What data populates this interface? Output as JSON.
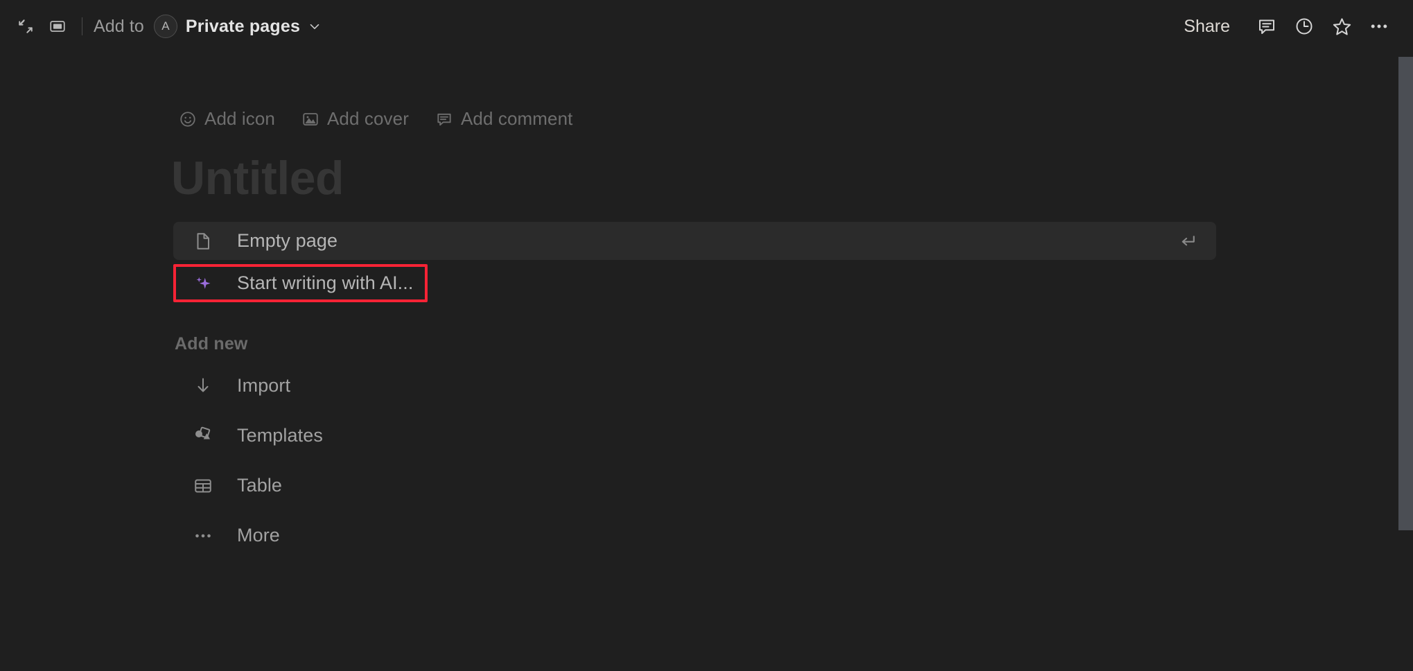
{
  "window": {
    "background": "#1f1f1f"
  },
  "topbar": {
    "expand_icon": "expand-diagonal-icon",
    "sidepeek_icon": "side-peek-icon",
    "add_to_label": "Add to",
    "workspace_avatar_letter": "A",
    "breadcrumb_title": "Private pages",
    "breadcrumb_chevron": "chevron-down-icon",
    "share_label": "Share",
    "comment_icon": "comment-icon",
    "history_icon": "clock-history-icon",
    "favorite_icon": "star-icon",
    "more_icon": "more-horizontal-icon"
  },
  "page": {
    "meta_actions": [
      {
        "icon": "smiley-face-icon",
        "label": "Add icon"
      },
      {
        "icon": "image-icon",
        "label": "Add cover"
      },
      {
        "icon": "comment-icon",
        "label": "Add comment"
      }
    ],
    "title_placeholder": "Untitled",
    "suggestions": [
      {
        "icon": "page-file-icon",
        "label": "Empty page",
        "selected": true,
        "hint_icon": "enter-key-icon"
      },
      {
        "icon": "ai-sparkle-icon",
        "label": "Start writing with AI...",
        "selected": false,
        "highlighted": true
      }
    ],
    "add_new_label": "Add new",
    "add_new_items": [
      {
        "icon": "import-download-icon",
        "label": "Import"
      },
      {
        "icon": "templates-shapes-icon",
        "label": "Templates"
      },
      {
        "icon": "table-grid-icon",
        "label": "Table"
      },
      {
        "icon": "more-horizontal-icon",
        "label": "More"
      }
    ]
  },
  "colors": {
    "accent_ai": "#9b6ddc",
    "highlight_box": "#f62335",
    "selected_row_bg": "#2b2b2b",
    "scrollbar_thumb": "#4b4e54"
  },
  "scrollbar": {
    "name": "vertical-scrollbar"
  }
}
